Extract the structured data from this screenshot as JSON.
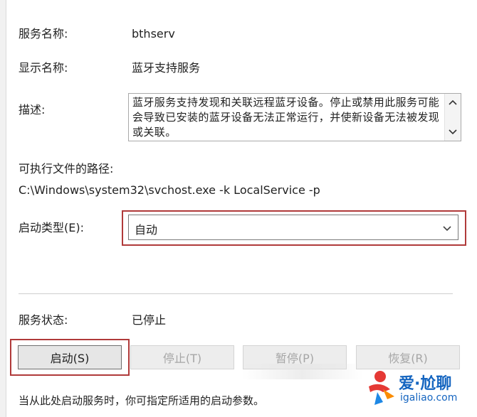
{
  "service_name": {
    "label": "服务名称:",
    "value": "bthserv"
  },
  "display_name": {
    "label": "显示名称:",
    "value": "蓝牙支持服务"
  },
  "description": {
    "label": "描述:",
    "text": "蓝牙服务支持发现和关联远程蓝牙设备。停止或禁用此服务可能会导致已安装的蓝牙设备无法正常运行，并使新设备无法被发现或关联。"
  },
  "executable": {
    "label": "可执行文件的路径:",
    "path": "C:\\Windows\\system32\\svchost.exe -k LocalService -p"
  },
  "startup_type": {
    "label": "启动类型(E):",
    "selected": "自动"
  },
  "service_status": {
    "label": "服务状态:",
    "value": "已停止"
  },
  "buttons": {
    "start": "启动(S)",
    "stop": "停止(T)",
    "pause": "暂停(P)",
    "resume": "恢复(R)"
  },
  "footer": {
    "hint": "当从此处启动服务时，你可指定所适用的启动参数。"
  },
  "watermark": {
    "brand": "爱·尬聊",
    "site": "igaliao.com"
  },
  "colors": {
    "highlight": "#b03a3a",
    "brand": "#1565c0"
  }
}
